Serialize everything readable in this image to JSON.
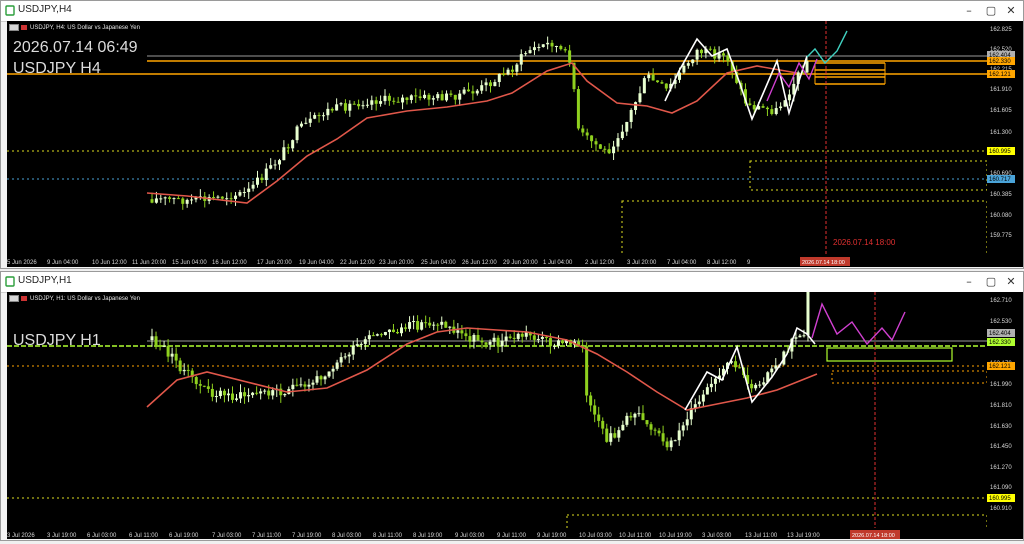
{
  "h4": {
    "window_title": "USDJPY,H4",
    "subtitle": "USDJPY, H4:  US Dollar vs Japanese Yen",
    "overlay_datetime": "2026.07.14 06:49",
    "overlay_symbol": "USDJPY H4",
    "vline_label": "2026.07.14 18:00",
    "vline_badge": "2026.07.14 18:00",
    "y_ticks": [
      "162.825",
      "162.520",
      "162.215",
      "161.910",
      "161.605",
      "161.300",
      "160.995",
      "160.690",
      "160.385",
      "160.080",
      "159.775"
    ],
    "badges": [
      {
        "text": "162.404",
        "bg": "#b0b0b0",
        "fg": "#000000"
      },
      {
        "text": "162.330",
        "bg": "#ffa500",
        "fg": "#000000"
      },
      {
        "text": "162.121",
        "bg": "#ffa500",
        "fg": "#000000"
      },
      {
        "text": "160.995",
        "bg": "#ffff00",
        "fg": "#000000"
      },
      {
        "text": "160.717",
        "bg": "#4aa3d8",
        "fg": "#000000"
      }
    ],
    "x_ticks": [
      "5 Jun 2026",
      "9 Jun 04:00",
      "10 Jun 12:00",
      "11 Jun 20:00",
      "15 Jun 04:00",
      "16 Jun 12:00",
      "17 Jun 20:00",
      "19 Jun 04:00",
      "22 Jun 12:00",
      "23 Jun 20:00",
      "25 Jun 04:00",
      "26 Jun 12:00",
      "29 Jun 20:00",
      "1 Jul 04:00",
      "2 Jul 12:00",
      "3 Jul 20:00",
      "7 Jul 04:00",
      "8 Jul 12:00",
      "9"
    ],
    "colors": {
      "bull": "#e8ffd0",
      "bear": "#8fd11f",
      "ma": "#e0574a",
      "orange": "#ffa500",
      "yellow": "#dede20",
      "cyan": "#4aa3d8",
      "white": "#ffffff",
      "magenta": "#d040d0",
      "teal": "#40d0c0",
      "red": "#e03030"
    }
  },
  "h1": {
    "window_title": "USDJPY,H1",
    "subtitle": "USDJPY, H1:  US Dollar vs Japanese Yen",
    "overlay_symbol": "USDJPY H1",
    "vline_label": "2026.07.14 18:00",
    "vline_badge": "2026.07.14 18:00",
    "y_ticks": [
      "162.710",
      "162.530",
      "162.350",
      "162.170",
      "161.990",
      "161.810",
      "161.630",
      "161.450",
      "161.270",
      "161.090",
      "160.910"
    ],
    "badges": [
      {
        "text": "162.404",
        "bg": "#b0b0b0",
        "fg": "#000000"
      },
      {
        "text": "162.330",
        "bg": "#b0ff30",
        "fg": "#000000"
      },
      {
        "text": "162.121",
        "bg": "#ffa500",
        "fg": "#000000"
      },
      {
        "text": "160.995",
        "bg": "#ffff00",
        "fg": "#000000"
      }
    ],
    "x_ticks": [
      "3 Jul 2026",
      "3 Jul 19:00",
      "6 Jul 03:00",
      "6 Jul 11:00",
      "6 Jul 19:00",
      "7 Jul 03:00",
      "7 Jul 11:00",
      "7 Jul 19:00",
      "8 Jul 03:00",
      "8 Jul 11:00",
      "8 Jul 19:00",
      "9 Jul 03:00",
      "9 Jul 11:00",
      "9 Jul 19:00",
      "10 Jul 03:00",
      "10 Jul 11:00",
      "10 Jul 19:00",
      "3 Jul 03:00",
      "13 Jul 11:00",
      "13 Jul 19:00"
    ]
  }
}
